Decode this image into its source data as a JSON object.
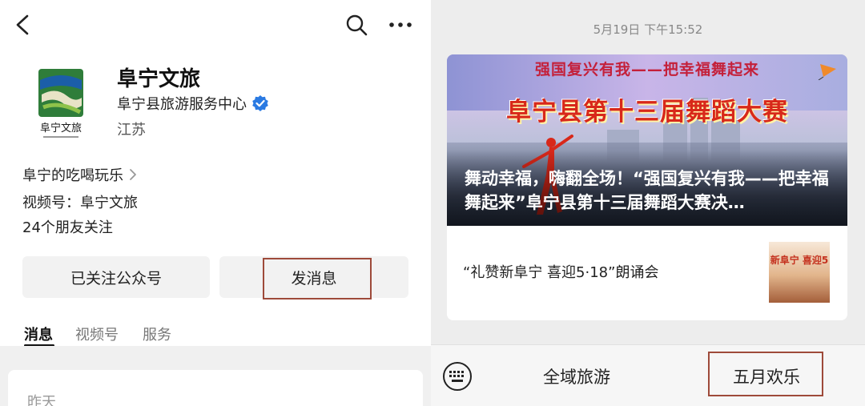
{
  "profile": {
    "name": "阜宁文旅",
    "organization": "阜宁县旅游服务中心",
    "region": "江苏",
    "logo_text": "阜宁文旅",
    "verified": true
  },
  "info": {
    "tagline": "阜宁的吃喝玩乐",
    "channels": "视频号：阜宁文旅",
    "friends": "24个朋友关注"
  },
  "actions": {
    "follow_label": "已关注公众号",
    "send_label": "发消息"
  },
  "tabs": [
    {
      "label": "消息",
      "active": true
    },
    {
      "label": "视频号",
      "active": false
    },
    {
      "label": "服务",
      "active": false
    }
  ],
  "message_list": {
    "date": "昨天"
  },
  "chat": {
    "timestamp": "5月19日 下午15:52",
    "article": {
      "banner_slogan": "强国复兴有我——把幸福舞起来",
      "banner_event": "阜宁县第十三届舞蹈大赛",
      "title": "舞动幸福，嗨翻全场！“强国复兴有我——把幸福舞起来”阜宁县第十三届舞蹈大赛决…"
    },
    "sub_article": {
      "title": "“礼赞新阜宁 喜迎5·18”朗诵会",
      "thumb_text": "新阜宁 喜迎5"
    }
  },
  "menu": {
    "items": [
      "全域旅游",
      "五月欢乐"
    ]
  },
  "colors": {
    "highlight_border": "#9e4a3a",
    "verified_blue": "#2a7ae2",
    "banner_red": "#d8281a"
  }
}
